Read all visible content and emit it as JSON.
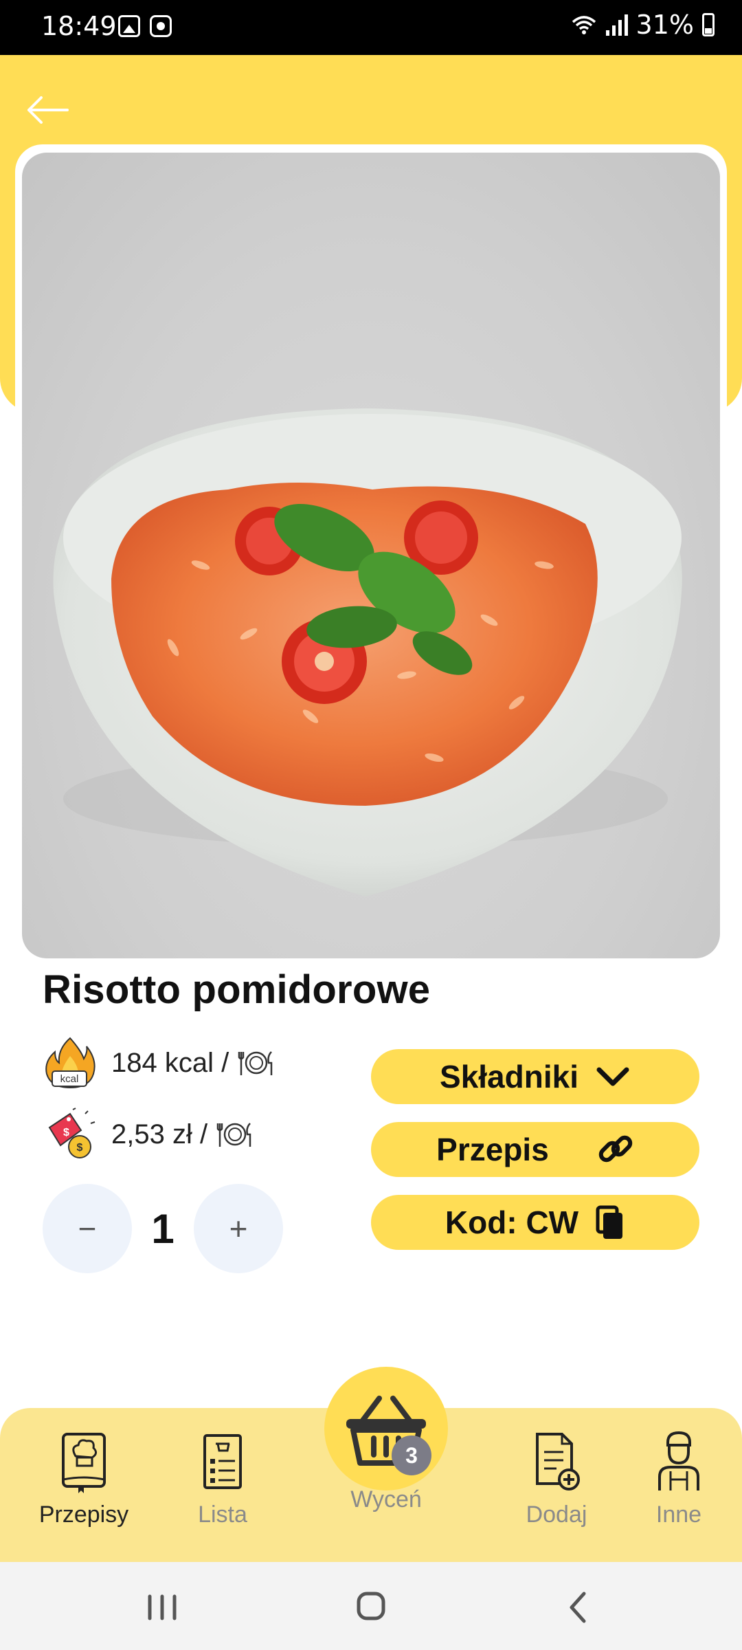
{
  "status_bar": {
    "time": "18:49",
    "battery": "31%",
    "icons": [
      "image-notification-icon",
      "clock-notification-icon",
      "wifi-icon",
      "signal-icon",
      "battery-icon"
    ]
  },
  "header": {
    "back_icon": "arrow-left-icon",
    "background_color": "#ffdd55"
  },
  "recipe": {
    "title": "Risotto pomidorowe",
    "photo": "tomato-rice-bowl-photo",
    "calories": "184 kcal /",
    "cost": "2,53 zł /",
    "quantity": "1",
    "decrement_label": "−",
    "increment_label": "+"
  },
  "actions": {
    "ingredients_label": "Składniki",
    "recipe_label": "Przepis",
    "code_label": "Kod: CW",
    "ingredients_icon": "chevron-down-icon",
    "recipe_icon": "link-icon",
    "code_icon": "copy-icon"
  },
  "bottom_nav": {
    "items": [
      {
        "label": "Przepisy",
        "icon": "cookbook-icon",
        "active": true
      },
      {
        "label": "Lista",
        "icon": "shopping-list-icon",
        "active": false
      },
      {
        "label": "Wyceń",
        "icon": "basket-icon",
        "active": false
      },
      {
        "label": "Dodaj",
        "icon": "add-document-icon",
        "active": false
      },
      {
        "label": "Inne",
        "icon": "chef-person-icon",
        "active": false
      }
    ],
    "basket_count": "3"
  },
  "colors": {
    "accent": "#ffdd55",
    "nav_background": "#fbe690",
    "badge": "#7c7c87"
  }
}
